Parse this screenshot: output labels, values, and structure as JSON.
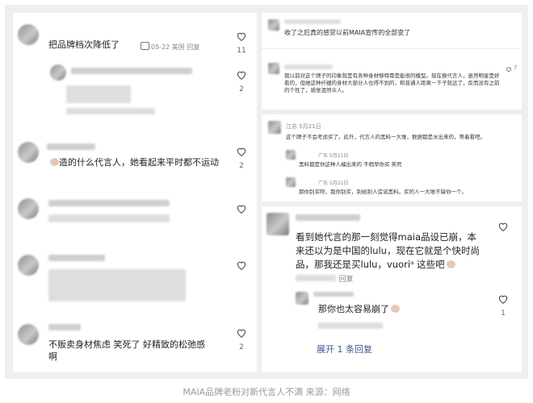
{
  "left_panel": {
    "comments": [
      {
        "text": "把品牌档次降低了",
        "meta": "05-22 美国  回复",
        "likes": "11"
      },
      {
        "likes": "2"
      },
      {
        "text": "造的什么代言人，她看起来平时都不运动",
        "likes": "2"
      },
      {
        "text": "不贩卖身材焦虑 笑死了 好精致的松弛感啊",
        "likes": "2"
      }
    ]
  },
  "right_panel": {
    "top_comment": "收了之后真的感觉以前MAIA宣传的全部变了",
    "long_comment": "我以前对这个牌子的印象就是有各种身材够特辱是能很的模型。现在换代言人，虽然明星是好看的，但她这种纤细的身材大部分人也得不到的，和普通人距离一下子就远了，反而没有之前的个性了，感觉泯然众人。",
    "long_likes": "7",
    "thread_comment": "这个牌子不会考虑买了。此外，代言人的黑料一大堆，数据都是水出来的，等着看吧。",
    "thread_meta": "江苏 5月21日",
    "reply1": "黑料都是你这种人编出来的 不稍早你买 笑死",
    "reply1_meta": "广东 5月21日",
    "reply2": "那你别买呗，我你别买，别给别人造谣黑料。买的人一大堆不缺你一个。",
    "reply2_meta": "广东 5月21日",
    "main_comment": "看到她代言的那一刻觉得maia品设已崩，本来还以为是中国的lulu，现在它就是个快时尚品，那我还是买lulu，vuoriᵃ 这些吧",
    "main_meta": "回复",
    "sub_reply": "那你也太容易崩了",
    "sub_likes": "1",
    "expand_label": "展开 1 条回复"
  },
  "caption": "MAIA品牌老粉对新代言人不满 来源：网络",
  "colors": {
    "background": "#efefef",
    "panel": "#ffffff",
    "link": "#3b5a8c",
    "caption": "#9a9a9a"
  }
}
